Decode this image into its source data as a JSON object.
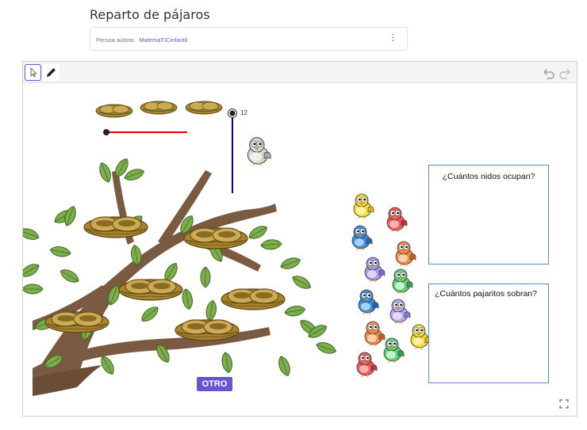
{
  "page": {
    "title": "Reparto de pájaros",
    "author_label": "Persoa autora:",
    "author_name": "MatemaTICinfantil",
    "menu_icon": "more-vertical-icon"
  },
  "toolbar": {
    "tools": [
      {
        "name": "move-tool",
        "icon": "pointer-icon",
        "selected": true
      },
      {
        "name": "pen-tool",
        "icon": "pencil-icon",
        "selected": false
      }
    ],
    "undo_icon": "undo-icon",
    "redo_icon": "redo-icon"
  },
  "applet": {
    "slider_value": "12",
    "questions": {
      "nests": "¿Cuántos nidos ocupan?",
      "birds": "¿Cuántos pajaritos sobran?"
    },
    "otro_label": "OTRO",
    "fullscreen_icon": "fullscreen-icon",
    "colors": {
      "accent": "#6557d2",
      "horizontal_slider": "#dd0000",
      "vertical_slider": "#000099",
      "question_border": "#5b8ec9"
    }
  }
}
